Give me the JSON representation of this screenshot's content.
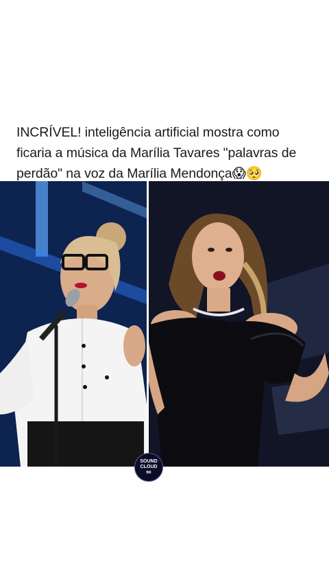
{
  "post": {
    "caption_line1": "INCRÍVEL! inteligência artificial mostra como",
    "caption_line2": "ficaria a música da Marília Tavares \"palavras de",
    "caption_line3": "perdão\" na voz da Marília Mendonça😱🥺"
  },
  "logo": {
    "line1": "SOUND",
    "line2": "CLOUD",
    "line3": "BR"
  }
}
